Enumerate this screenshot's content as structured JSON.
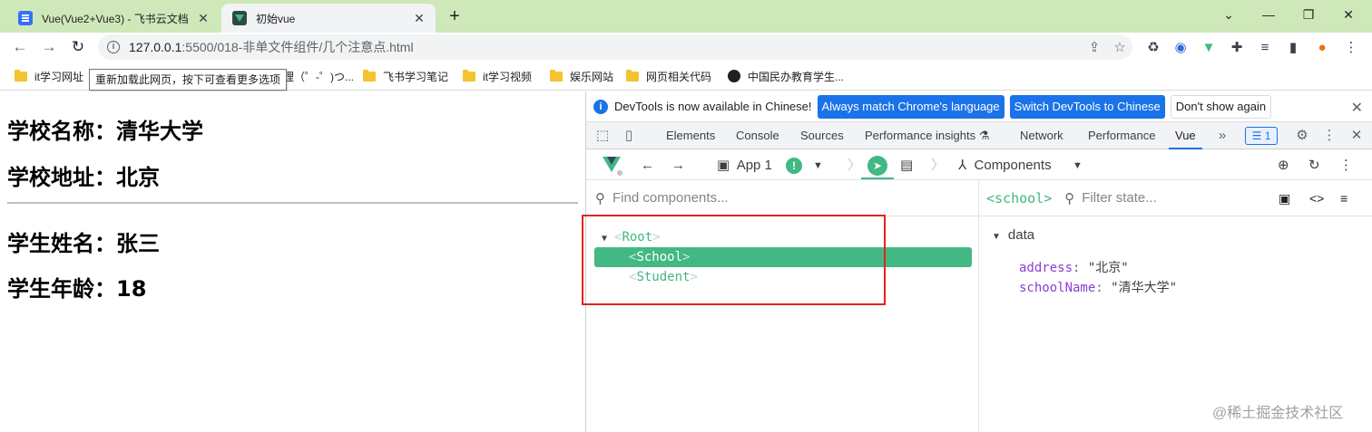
{
  "tabs": [
    {
      "title": "Vue(Vue2+Vue3) - 飞书云文档",
      "icon": "doc-icon"
    },
    {
      "title": "初始vue",
      "icon": "vue-icon"
    }
  ],
  "address": {
    "host": "127.0.0.1",
    "path": ":5500/018-非单文件组件/几个注意点.html"
  },
  "bookmarks": [
    "it学习网址",
    "理（゜-゜)つ...",
    "飞书学习笔记",
    "it学习视频",
    "娱乐网站",
    "网页相关代码",
    "中国民办教育学生..."
  ],
  "tooltip": "重新加载此网页，按下可查看更多选项",
  "page": {
    "school_name": "学校名称：清华大学",
    "school_address": "学校地址：北京",
    "student_name": "学生姓名：张三",
    "student_age": "学生年龄：18"
  },
  "devtools": {
    "infobar": {
      "message": "DevTools is now available in Chinese!",
      "btn_match": "Always match Chrome's language",
      "btn_switch": "Switch DevTools to Chinese",
      "btn_dismiss": "Don't show again"
    },
    "tabs": [
      "Elements",
      "Console",
      "Sources",
      "Performance insights",
      "Network",
      "Performance",
      "Vue"
    ],
    "active_tab": "Vue",
    "issues_count": "1",
    "vue": {
      "app_label": "App 1",
      "components_label": "Components",
      "search_placeholder": "Find components...",
      "tree": {
        "root": "Root",
        "school": "School",
        "student": "Student"
      },
      "selected_component": "<school>",
      "filter_placeholder": "Filter state...",
      "section": "data",
      "props": [
        {
          "key": "address",
          "value": "\"北京\""
        },
        {
          "key": "schoolName",
          "value": "\"清华大学\""
        }
      ]
    }
  },
  "watermark": "@稀土掘金技术社区",
  "colors": {
    "vue_green": "#42b883",
    "chrome_blue": "#1a73e8",
    "highlight_red": "#e0241f",
    "tabstrip": "#cfe8b9"
  }
}
